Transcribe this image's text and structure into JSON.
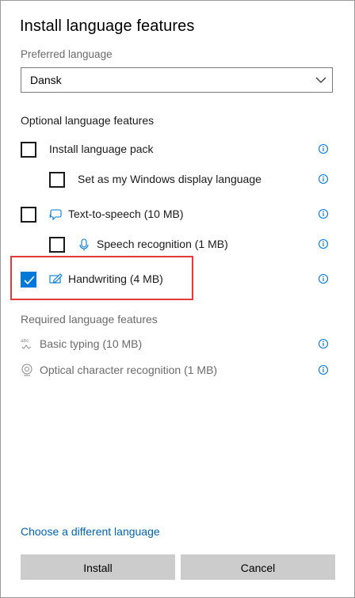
{
  "dialog": {
    "title": "Install language features",
    "preferred_language_label": "Preferred language",
    "preferred_language_value": "Dansk",
    "optional_section_label": "Optional language features",
    "optional_features": [
      {
        "label": "Install language pack",
        "checked": false
      },
      {
        "label": "Set as my Windows display language",
        "checked": false
      },
      {
        "label": "Text-to-speech (10 MB)",
        "checked": false,
        "icon": "text-to-speech-icon"
      },
      {
        "label": "Speech recognition (1 MB)",
        "checked": false,
        "icon": "microphone-icon"
      },
      {
        "label": "Handwriting (4 MB)",
        "checked": true,
        "icon": "handwriting-icon"
      }
    ],
    "required_section_label": "Required language features",
    "required_features": [
      {
        "label": "Basic typing (10 MB)",
        "icon": "abc-typing-icon"
      },
      {
        "label": "Optical character recognition (1 MB)",
        "icon": "ocr-camera-icon"
      }
    ],
    "choose_language_link": "Choose a different language",
    "install_button": "Install",
    "cancel_button": "Cancel"
  },
  "colors": {
    "accent": "#0078d7",
    "link": "#0063b1",
    "highlight_box": "#e23b3b",
    "button_bg": "#cccccc"
  }
}
